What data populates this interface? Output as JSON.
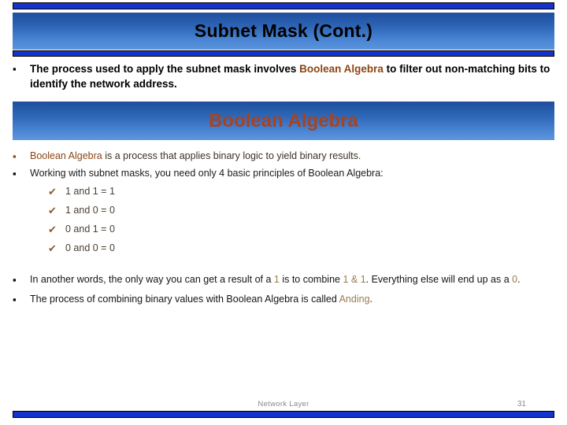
{
  "slide": {
    "title": "Subnet Mask (Cont.)",
    "section_header": "Boolean Algebra",
    "intro": {
      "part1": "The process used to apply the subnet mask involves ",
      "highlight": "Boolean Algebra",
      "part2": " to filter out non-matching bits to identify the network address."
    },
    "body": {
      "item1_highlight": "Boolean Algebra",
      "item1_rest": " is a process that applies binary logic to yield binary results.",
      "item2": "Working with subnet masks, you need only 4 basic principles of Boolean Algebra:",
      "checks": [
        "1 and 1 = 1",
        "1 and 0 = 0",
        "0 and 1 = 0",
        "0 and 0 = 0"
      ]
    },
    "tail": {
      "item1_a": "In another words, the only way you can get a result of a ",
      "item1_one": "1",
      "item1_b": " is to combine ",
      "item1_combo": "1 & 1",
      "item1_c": ".  Everything else will end up as a ",
      "item1_zero": "0",
      "item1_d": ".",
      "item2_a": "The process of combining binary values with Boolean Algebra is called ",
      "item2_anding": "Anding",
      "item2_b": "."
    },
    "footer": {
      "label": "Network Layer",
      "page": "31"
    },
    "colors": {
      "accent_blue": "#1433cc",
      "band_dark": "#1f4e9c",
      "band_light": "#5f96de",
      "brown": "#8B4513",
      "rust": "#a8431f",
      "tan": "#9b7a52",
      "footer_gray": "#8a8a8a"
    }
  }
}
